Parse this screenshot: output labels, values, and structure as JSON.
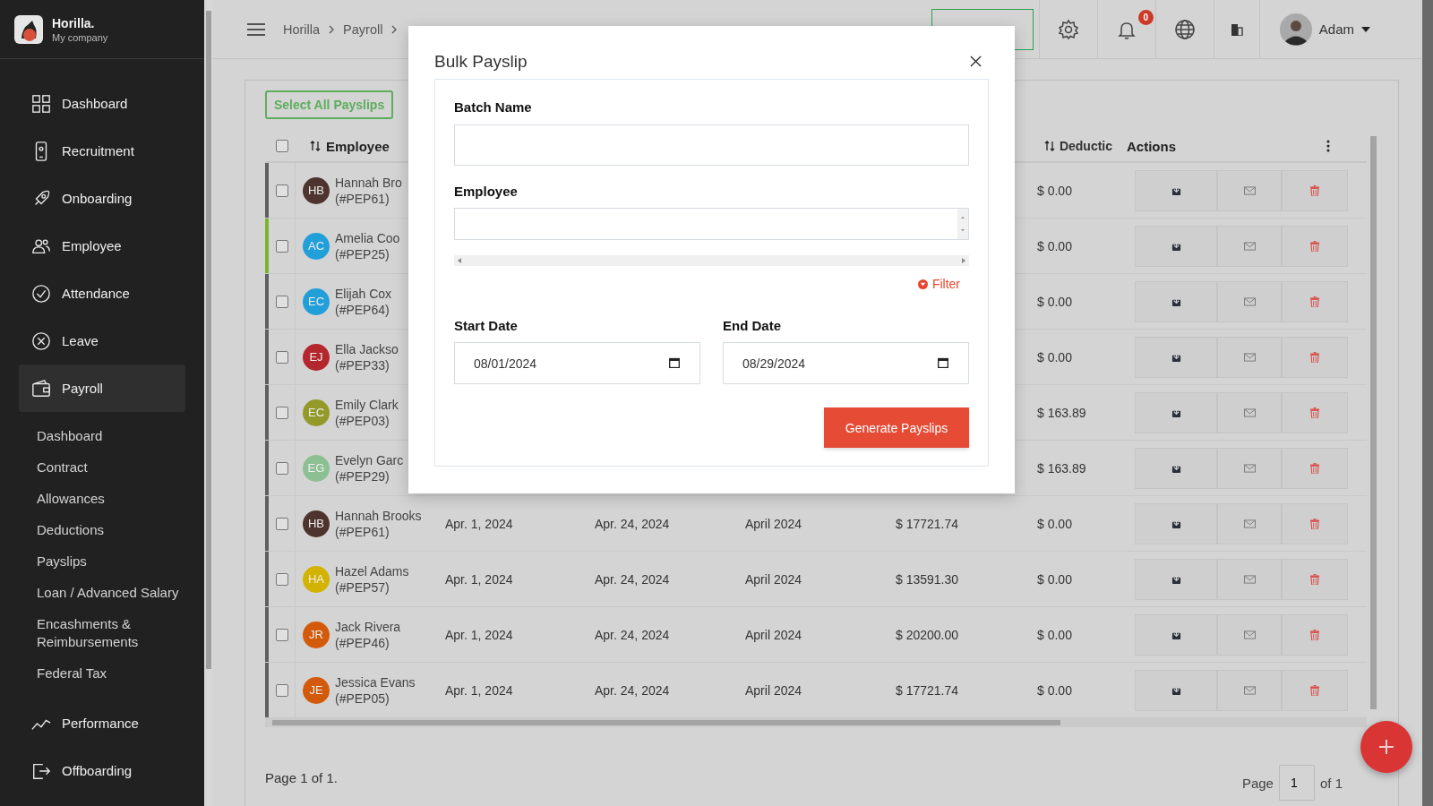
{
  "sidebar": {
    "brand": {
      "name": "Horilla.",
      "company": "My company"
    },
    "items": [
      {
        "label": "Dashboard",
        "selected": false
      },
      {
        "label": "Recruitment",
        "selected": false
      },
      {
        "label": "Onboarding",
        "selected": false
      },
      {
        "label": "Employee",
        "selected": false
      },
      {
        "label": "Attendance",
        "selected": false
      },
      {
        "label": "Leave",
        "selected": false
      },
      {
        "label": "Payroll",
        "selected": true,
        "children": [
          {
            "label": "Dashboard",
            "selected": false
          },
          {
            "label": "Contract",
            "selected": false
          },
          {
            "label": "Allowances",
            "selected": false
          },
          {
            "label": "Deductions",
            "selected": false
          },
          {
            "label": "Payslips",
            "selected": false
          },
          {
            "label": "Loan / Advanced Salary",
            "selected": false
          },
          {
            "label": "Encashments & Reimbursements",
            "selected": false
          },
          {
            "label": "Federal Tax",
            "selected": false
          }
        ]
      },
      {
        "label": "Performance",
        "selected": false
      },
      {
        "label": "Offboarding",
        "selected": false
      }
    ]
  },
  "topbar": {
    "breadcrumb": [
      "Horilla",
      "Payroll"
    ],
    "notifications": "0",
    "user": "Adam"
  },
  "toolbar": {
    "select_all": "Select All Payslips"
  },
  "table": {
    "header_checked": false,
    "columns": [
      "Employee",
      "Deductic",
      "Actions"
    ],
    "rows": [
      {
        "name": "Hannah Bro",
        "code": "(#PEP61)",
        "initials": "HB",
        "color": "#4e342e",
        "stripe": {
          "color": "#5f5f5f"
        },
        "checked": false,
        "deduction": "$ 0.00"
      },
      {
        "name": "Amelia Coo",
        "code": "(#PEP25)",
        "initials": "AC",
        "color": "#209fd9",
        "stripe": {
          "color": "#7ab32e"
        },
        "checked": false,
        "deduction": "$ 0.00"
      },
      {
        "name": "Elijah Cox",
        "code": "(#PEP64)",
        "initials": "EC",
        "color": "#209fd9",
        "stripe": {
          "color": "#5f5f5f"
        },
        "checked": false,
        "deduction": "$ 0.00"
      },
      {
        "name": "Ella Jackso",
        "code": "(#PEP33)",
        "initials": "EJ",
        "color": "#b3272d",
        "stripe": {
          "color": "#5f5f5f"
        },
        "checked": false,
        "deduction": "$ 0.00"
      },
      {
        "name": "Emily Clark",
        "code": "(#PEP03)",
        "initials": "EC",
        "color": "#939a2a",
        "stripe": {
          "color": "#5f5f5f"
        },
        "checked": false,
        "deduction": "$ 163.89"
      },
      {
        "name": "Evelyn Garc",
        "code": "(#PEP29)",
        "initials": "EG",
        "color": "#8cbf92",
        "stripe": {
          "color": "#5f5f5f"
        },
        "checked": false,
        "deduction": "$ 163.89"
      },
      {
        "name": "Hannah Brooks",
        "code": "(#PEP61)",
        "initials": "HB",
        "color": "#4e342e",
        "stripe": {
          "color": "#5f5f5f"
        },
        "checked": false,
        "start": "Apr. 1, 2024",
        "end": "Apr. 24, 2024",
        "month": "April 2024",
        "gross": "$ 17721.74",
        "deduction": "$ 0.00"
      },
      {
        "name": "Hazel Adams",
        "code": "(#PEP57)",
        "initials": "HA",
        "color": "#d4b200",
        "stripe": {
          "color": "#5f5f5f"
        },
        "checked": false,
        "start": "Apr. 1, 2024",
        "end": "Apr. 24, 2024",
        "month": "April 2024",
        "gross": "$ 13591.30",
        "deduction": "$ 0.00"
      },
      {
        "name": "Jack Rivera",
        "code": "(#PEP46)",
        "initials": "JR",
        "color": "#d35a0a",
        "stripe": {
          "color": "#5f5f5f"
        },
        "checked": false,
        "start": "Apr. 1, 2024",
        "end": "Apr. 24, 2024",
        "month": "April 2024",
        "gross": "$ 20200.00",
        "deduction": "$ 0.00"
      },
      {
        "name": "Jessica Evans",
        "code": "(#PEP05)",
        "initials": "JE",
        "color": "#d35a0a",
        "stripe": {
          "color": "#5f5f5f"
        },
        "checked": false,
        "start": "Apr. 1, 2024",
        "end": "Apr. 24, 2024",
        "month": "April 2024",
        "gross": "$ 17721.74",
        "deduction": "$ 0.00"
      }
    ]
  },
  "footer": {
    "page_info": "Page 1 of 1.",
    "page_label": "Page",
    "page_value": "1",
    "page_total": "of 1"
  },
  "modal": {
    "title": "Bulk Payslip",
    "batch_label": "Batch Name",
    "employee_label": "Employee",
    "filter": "Filter",
    "start_label": "Start Date",
    "start_value": "08/01/2024",
    "end_label": "End Date",
    "end_value": "08/29/2024",
    "submit": "Generate Payslips"
  }
}
